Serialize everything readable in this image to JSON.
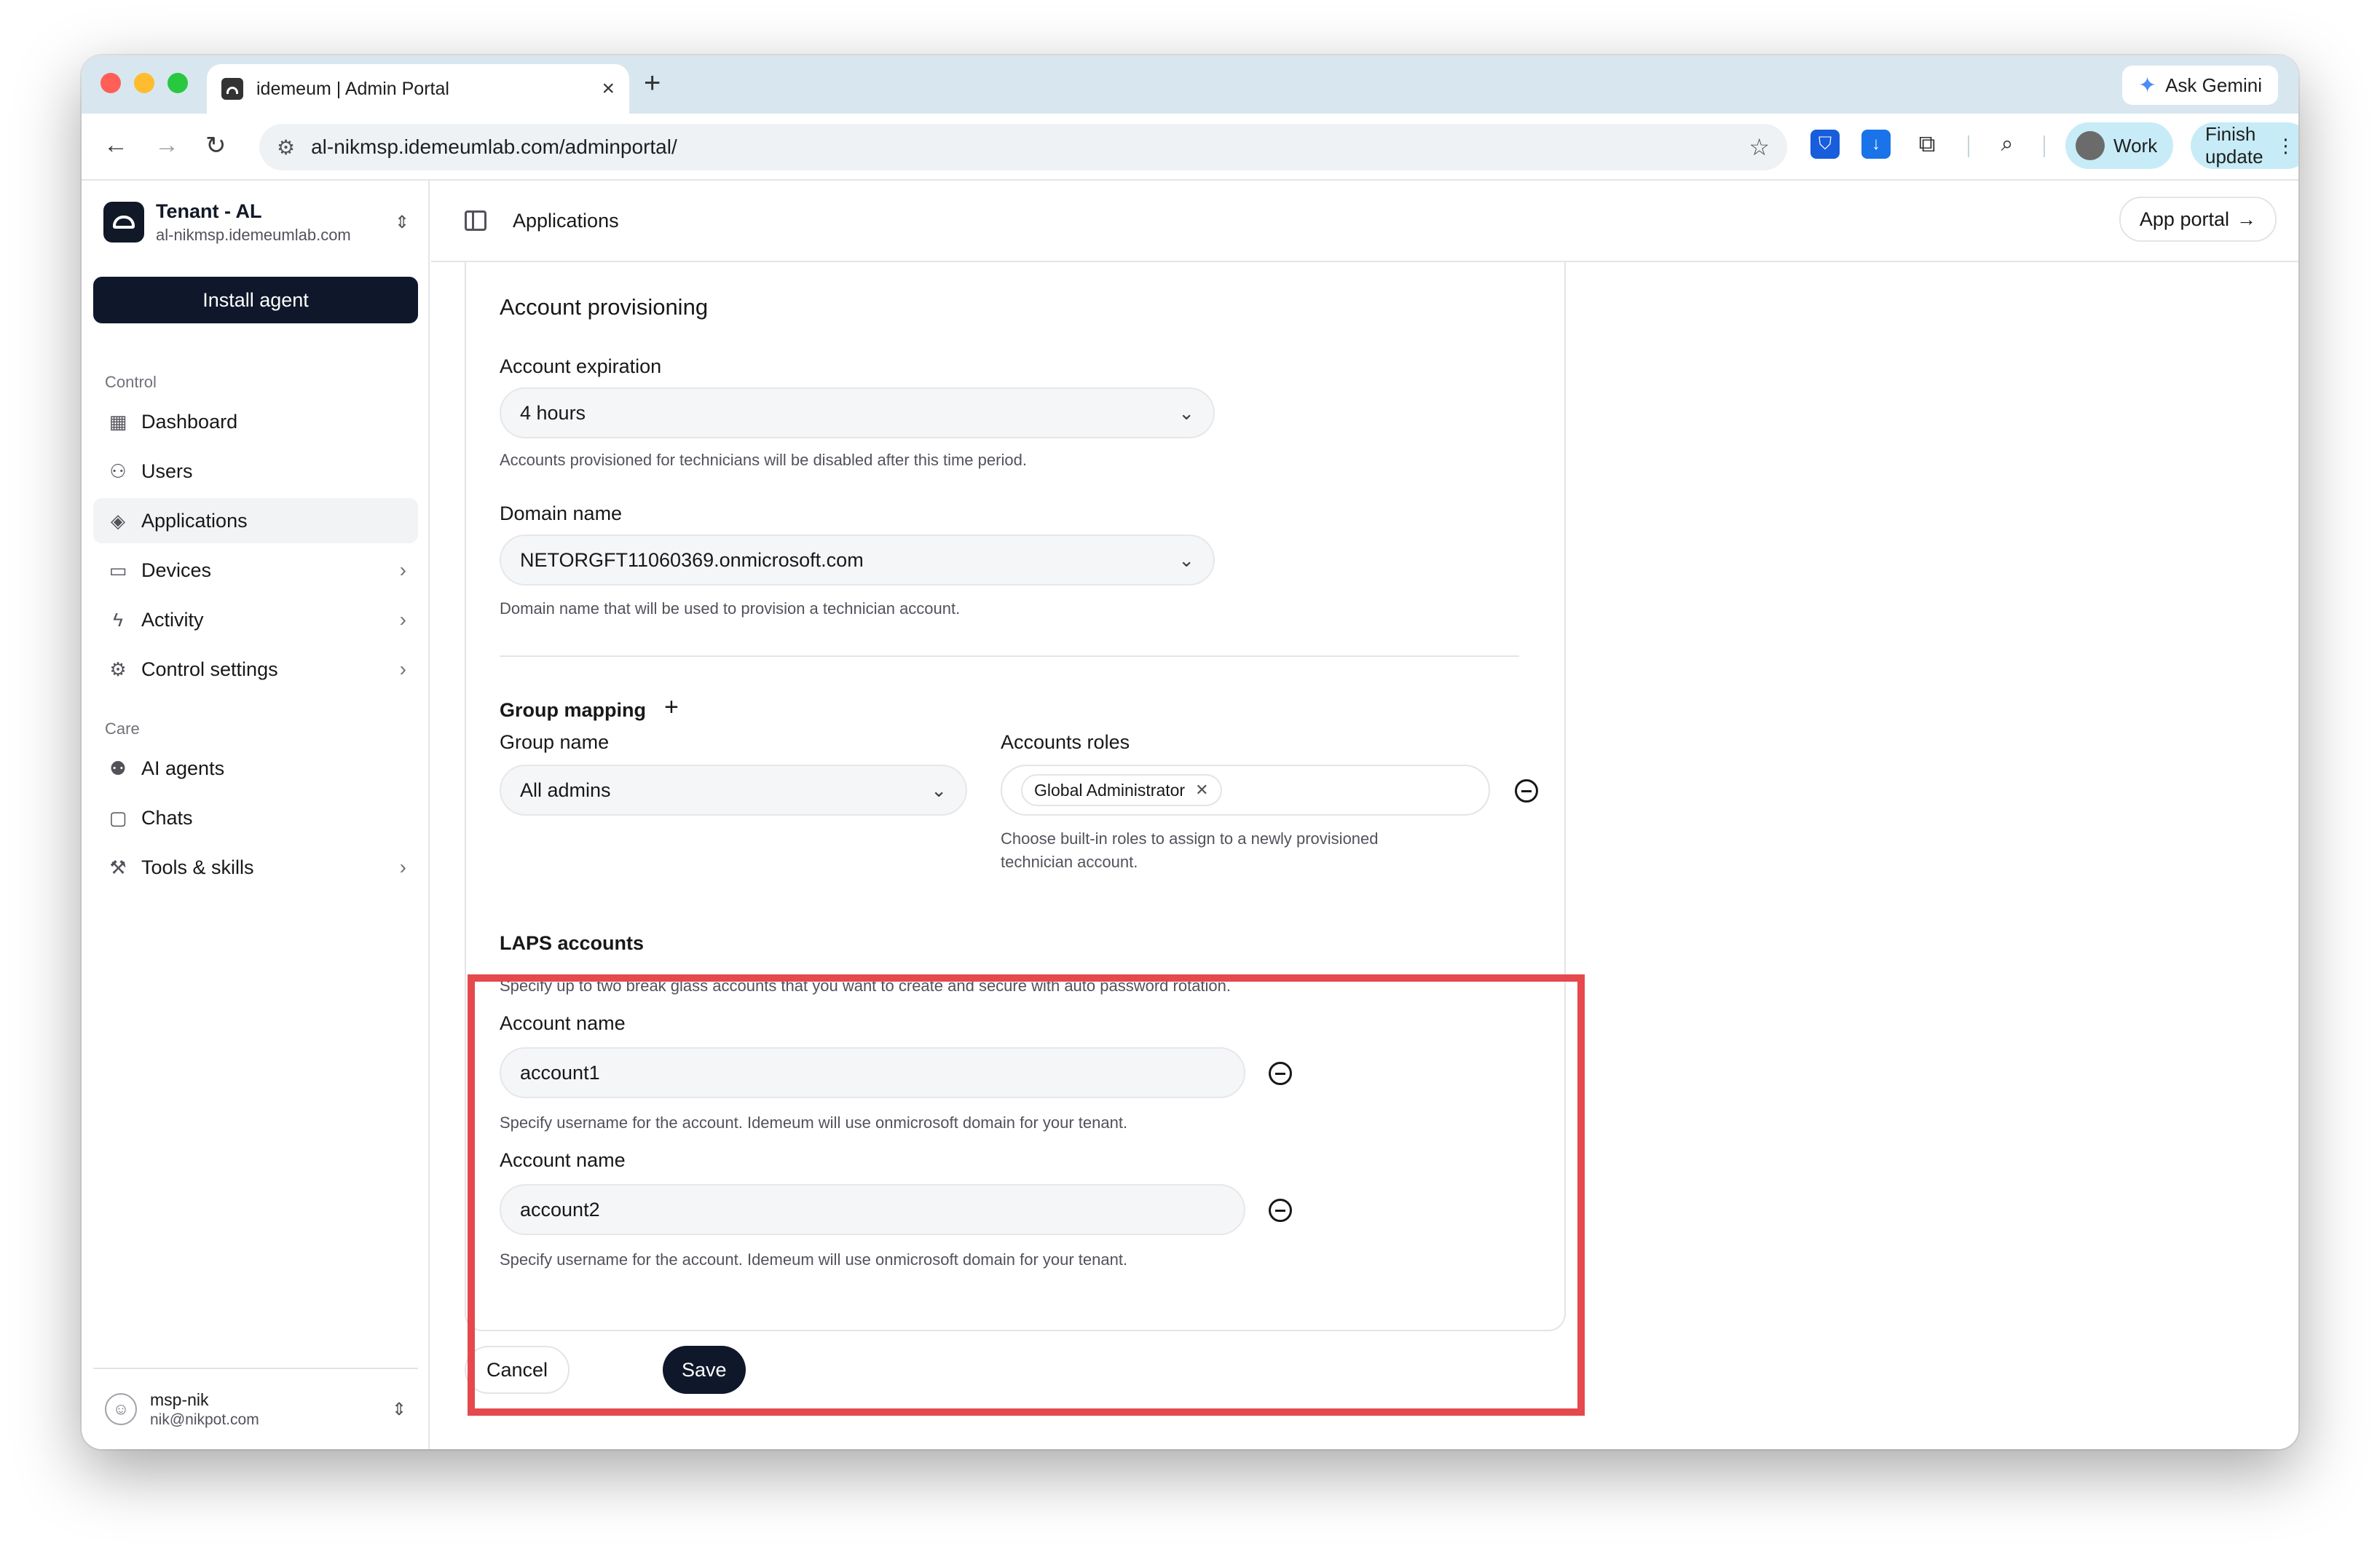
{
  "browser": {
    "tab_title": "idemeum | Admin Portal",
    "tab_close": "×",
    "new_tab": "+",
    "ask_gemini": "Ask Gemini",
    "url": "al-nikmsp.idemeumlab.com/adminportal/",
    "profile_label": "Work",
    "finish_update": "Finish update"
  },
  "sidebar": {
    "tenant_name": "Tenant - AL",
    "tenant_domain": "al-nikmsp.idemeumlab.com",
    "install_agent": "Install agent",
    "section_control": "Control",
    "section_care": "Care",
    "items": [
      {
        "label": "Dashboard"
      },
      {
        "label": "Users"
      },
      {
        "label": "Applications"
      },
      {
        "label": "Devices"
      },
      {
        "label": "Activity"
      },
      {
        "label": "Control settings"
      },
      {
        "label": "AI agents"
      },
      {
        "label": "Chats"
      },
      {
        "label": "Tools & skills"
      }
    ],
    "user_name": "msp-nik",
    "user_email": "nik@nikpot.com"
  },
  "header": {
    "title": "Applications",
    "app_portal": "App portal"
  },
  "form": {
    "section_title": "Account provisioning",
    "expiration_label": "Account expiration",
    "expiration_value": "4 hours",
    "expiration_help": "Accounts provisioned for technicians will be disabled after this time period.",
    "domain_label": "Domain name",
    "domain_value": "NETORGFT11060369.onmicrosoft.com",
    "domain_help": "Domain name that will be used to provision a technician account.",
    "group_mapping_label": "Group mapping",
    "group_name_label": "Group name",
    "group_name_value": "All admins",
    "roles_label": "Accounts roles",
    "role_chip": "Global Administrator",
    "roles_help": "Choose built-in roles to assign to a newly provisioned technician account.",
    "laps_title": "LAPS accounts",
    "laps_help": "Specify up to two break glass accounts that you want to create and secure with auto password rotation.",
    "laps_accounts": [
      {
        "label": "Account name",
        "value": "account1",
        "help": "Specify username for the account. Idemeum will use onmicrosoft domain for your tenant."
      },
      {
        "label": "Account name",
        "value": "account2",
        "help": "Specify username for the account. Idemeum will use onmicrosoft domain for your tenant."
      }
    ],
    "cancel": "Cancel",
    "save": "Save"
  },
  "colors": {
    "highlight": "#e5484d",
    "primary": "#0f172a"
  }
}
